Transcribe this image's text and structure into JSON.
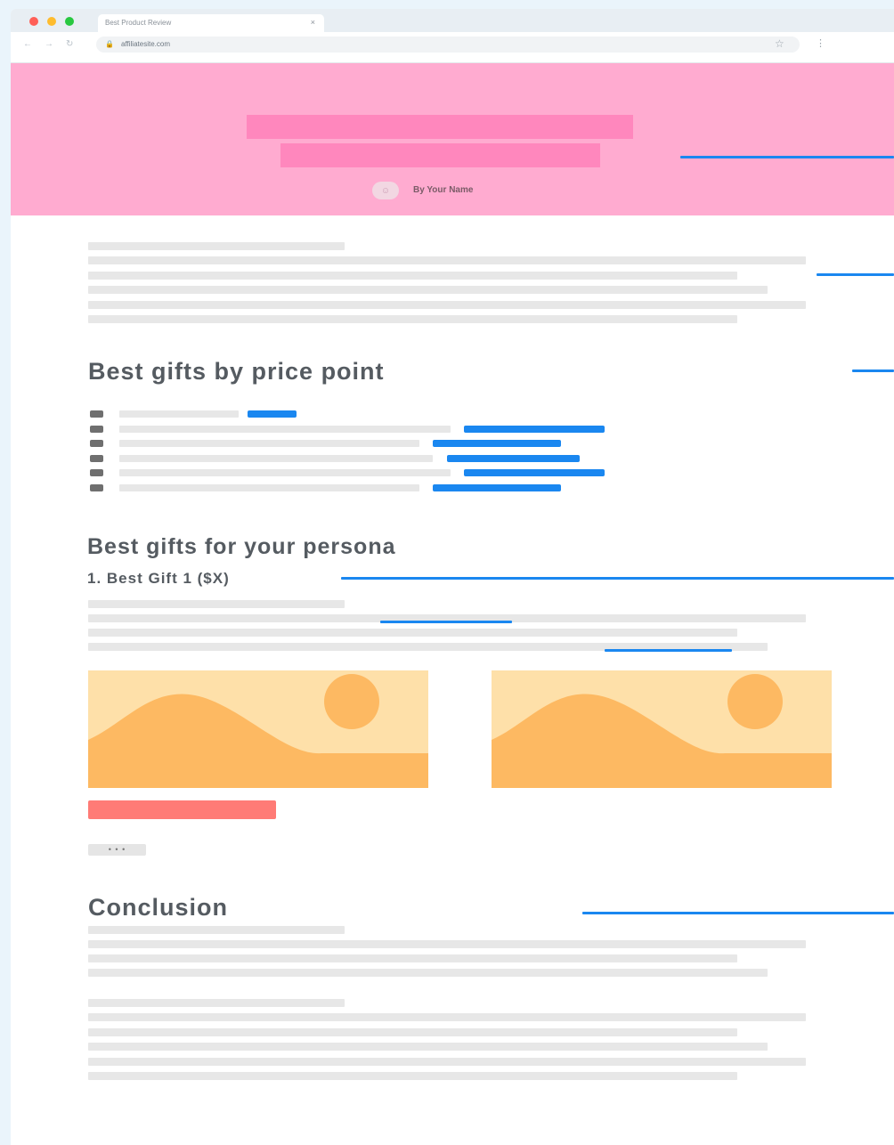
{
  "browser": {
    "tab_title": "Best Product Review",
    "tab_close": "×",
    "url": "affiliatesite.com",
    "back": "←",
    "forward": "→",
    "reload": "↻",
    "lock": "🔒",
    "star": "☆",
    "menu": "⋮"
  },
  "hero": {
    "author": "By Your Name",
    "avatar_glyph": "☺",
    "background": "#ffabd0",
    "title_bar_color": "#ff87bd"
  },
  "sections": {
    "price_heading": "Best gifts by price point",
    "persona_heading": "Best gifts for your persona",
    "gift_heading": "1. Best Gift 1 ($X)",
    "conclusion_heading": "Conclusion"
  },
  "buttons": {
    "more": "• • •"
  },
  "colors": {
    "link": "#1a87f0",
    "cta": "#ff7b76",
    "image_bg": "#fee0a9",
    "image_fg": "#fdb962",
    "placeholder": "#e7e7e7"
  }
}
